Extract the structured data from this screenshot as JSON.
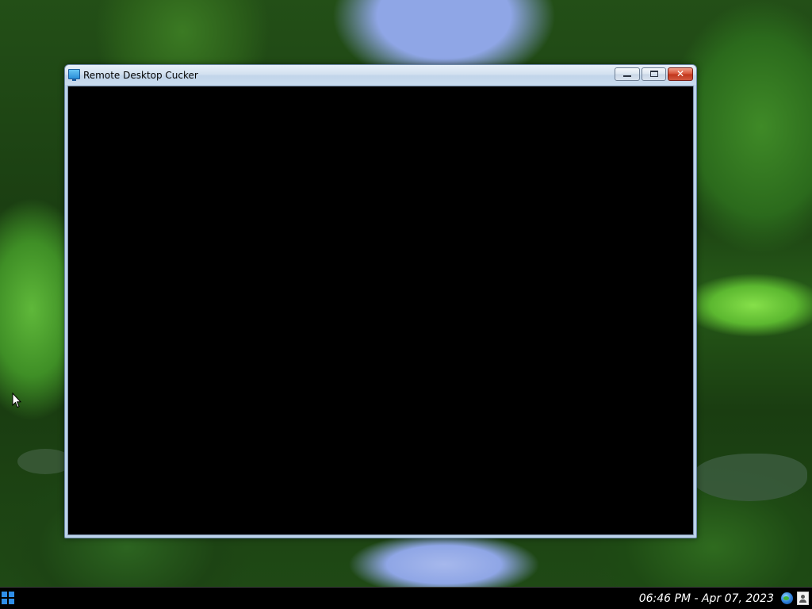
{
  "window": {
    "title": "Remote Desktop Cucker",
    "app_icon": "monitor-icon",
    "controls": {
      "minimize_icon": "minimize-icon",
      "maximize_icon": "maximize-icon",
      "close_icon": "close-icon",
      "close_glyph": "✕"
    },
    "client_area_color": "#000000"
  },
  "desktop": {
    "wallpaper": "forest-lake-icon",
    "cursor_icon": "arrow-cursor-icon"
  },
  "taskbar": {
    "start_icon": "start-menu-icon",
    "clock": "06:46 PM - Apr 07, 2023",
    "tray": {
      "network_icon": "globe-network-icon",
      "user_icon": "user-icon"
    }
  },
  "colors": {
    "start_accent": "#2f8ee8",
    "close_button": "#c1371d",
    "titlebar": "#d3e1f0",
    "taskbar": "#000000"
  }
}
